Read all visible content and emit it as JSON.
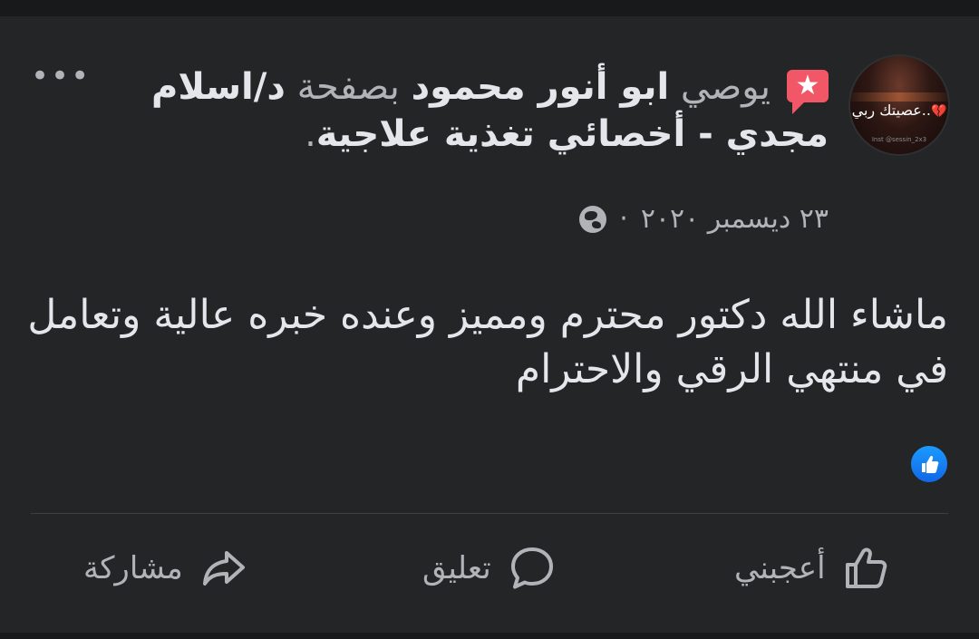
{
  "post": {
    "avatar": {
      "caption": "عصيتك ربي..",
      "heart": "💔",
      "footer_text": "Inst @sessin_2x3"
    },
    "badge_icon": "recommendation-star-icon",
    "header": {
      "author": "ابو أنور محمود",
      "verb": "يوصي",
      "connector": "بصفحة",
      "page_name": "د/اسلام مجدي - أخصائي تغذية علاجية",
      "end": "."
    },
    "more_label": "•••",
    "date": "٢٣ ديسمبر ٢٠٢٠",
    "separator": "·",
    "privacy_icon": "globe-icon",
    "body_text": "ماشاء الله دكتور محترم ومميز وعنده خبره عالية وتعامل في منتهي الرقي والاحترام",
    "reaction_icon": "like-reaction-icon"
  },
  "actions": {
    "like": "أعجبني",
    "comment": "تعليق",
    "share": "مشاركة"
  },
  "colors": {
    "background": "#18191a",
    "card": "#242526",
    "text": "#e4e6eb",
    "muted": "#b0b3b8",
    "badge": "#f25767",
    "like_blue": "#1877f2"
  }
}
